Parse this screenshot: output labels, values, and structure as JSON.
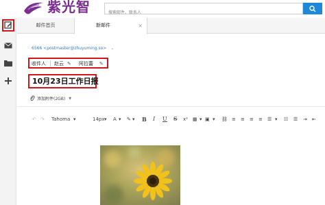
{
  "header": {
    "logo_text": "紫光智",
    "search_placeholder": "搜索邮件、联系人"
  },
  "tabs": [
    {
      "label": "邮件首页"
    },
    {
      "label": "新邮件",
      "close": "×"
    }
  ],
  "compose": {
    "from": "6566 <postmaster@zhuyuming.so>",
    "from_caret": "⌄",
    "recipients_label": "收件人",
    "recipients": [
      {
        "name": "赵云"
      },
      {
        "name": "阿拉蕾"
      }
    ],
    "subject": "10月23日工作日报",
    "attach_label": "添加附件(2GB)",
    "attach_caret": "▼"
  },
  "toolbar": {
    "undo": "↶",
    "redo": "↷",
    "font_family": "Tahoma",
    "font_size": "14px",
    "caret": "▾",
    "bold": "B",
    "italic": "I",
    "underline": "U",
    "strike": "S"
  },
  "colors": {
    "accent": "#1e88d8",
    "highlight_box": "#d1161b",
    "brand": "#7a2f8f"
  }
}
